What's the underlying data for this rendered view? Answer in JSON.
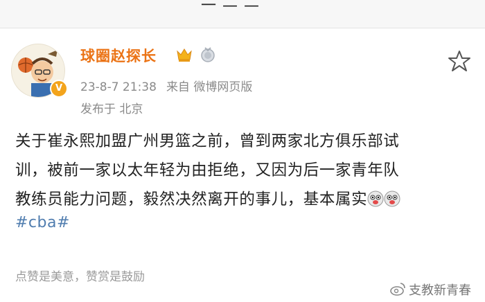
{
  "top_bar": {
    "partial_text": "一 — —"
  },
  "post": {
    "username": "球圈赵探长",
    "verified_mark": "V",
    "time": "23-8-7 21:38",
    "source": "来自 微博网页版",
    "location": "发布于 北京",
    "content_lines": [
      "关于崔永熙加盟广州男篮之前，曾到两家北方俱乐部试",
      "训，被前一家以太年轻为由拒绝，又因为后一家青年队",
      "教练员能力问题，毅然决然离开的事儿，基本属实"
    ],
    "emoji_names": [
      "doge-emoji",
      "doge-emoji"
    ],
    "hashtag": "#cba#",
    "reward_hint": "点赞是美意，赞赏是鼓励"
  },
  "watermark": {
    "text": "支教新青春",
    "icon": "weibo-icon"
  },
  "colors": {
    "username": "#eb7315",
    "hashtag": "#507daf",
    "meta": "#8a8a8a"
  }
}
